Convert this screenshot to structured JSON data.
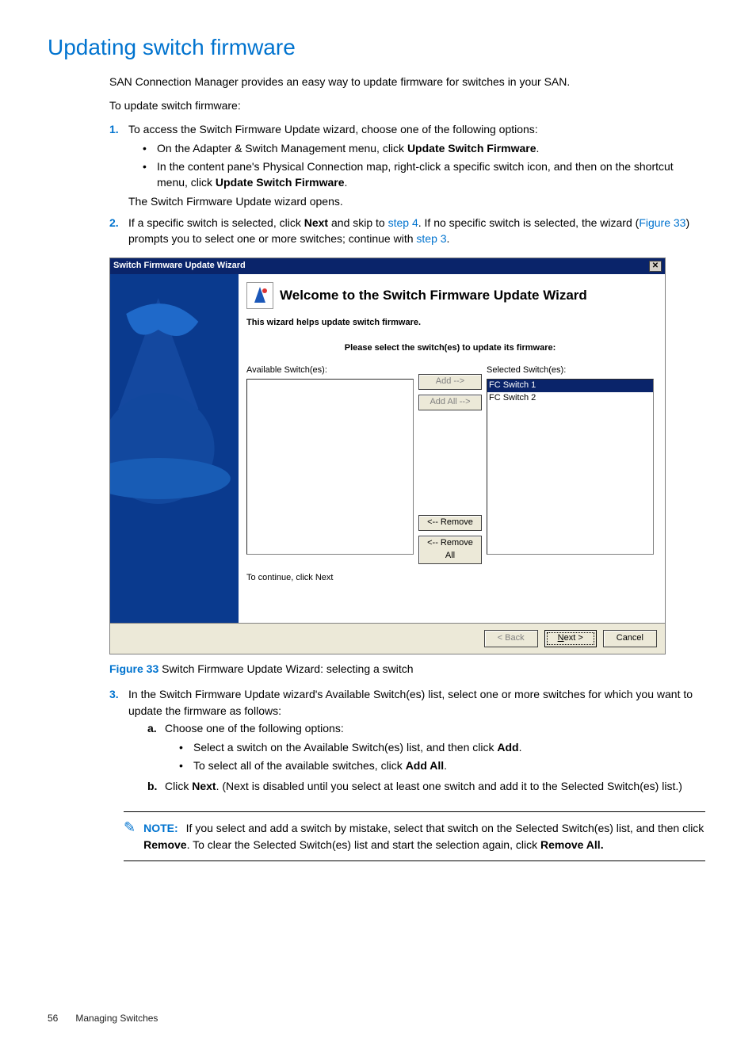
{
  "page_title": "Updating switch firmware",
  "intro1": "SAN Connection Manager provides an easy way to update firmware for switches in your SAN.",
  "intro2": "To update switch firmware:",
  "step1": {
    "text": "To access the Switch Firmware Update wizard, choose one of the following options:",
    "bullets": {
      "b1a": "On the Adapter & Switch Management menu, click ",
      "b1b_bold": "Update Switch Firmware",
      "b1c": ".",
      "b2a": "In the content pane's Physical Connection map, right-click a specific switch icon, and then on the shortcut menu, click ",
      "b2b_bold": "Update Switch Firmware",
      "b2c": "."
    },
    "after": "The Switch Firmware Update wizard opens."
  },
  "step2": {
    "t1": "If a specific switch is selected, click ",
    "t2_bold": "Next",
    "t3": " and skip to ",
    "link1": "step 4",
    "t4": ". If no specific switch is selected, the wizard (",
    "link2": "Figure 33",
    "t5": ") prompts you to select one or more switches; continue with ",
    "link3": "step 3",
    "t6": "."
  },
  "figure": {
    "ref": "Figure 33",
    "caption": " Switch Firmware Update Wizard: selecting a switch"
  },
  "wizard": {
    "title": "Switch Firmware Update Wizard",
    "heading": "Welcome to the Switch Firmware Update Wizard",
    "subtitle": "This wizard helps update switch firmware.",
    "prompt": "Please select the switch(es) to update its firmware:",
    "avail_label": "Available Switch(es):",
    "sel_label": "Selected Switch(es):",
    "selected": [
      "FC Switch 1",
      "FC Switch 2"
    ],
    "btn_add": "Add -->",
    "btn_addall": "Add All -->",
    "btn_remove": "<-- Remove",
    "btn_removeall": "<-- Remove All",
    "continue_hint": "To continue, click Next",
    "back": "< Back",
    "next": "Next >",
    "cancel": "Cancel"
  },
  "step3": {
    "text": "In the Switch Firmware Update wizard's Available Switch(es) list, select one or more switches for which you want to update the firmware as follows:",
    "a_text": "Choose one of the following options:",
    "a_b1a": "Select a switch on the Available Switch(es) list, and then click ",
    "a_b1b_bold": "Add",
    "a_b1c": ".",
    "a_b2a": "To select all of the available switches, click ",
    "a_b2b_bold": "Add All",
    "a_b2c": ".",
    "b_t1": "Click ",
    "b_t2_bold": "Next",
    "b_t3": ". (Next is disabled until you select at least one switch and add it to the Selected Switch(es) list.)"
  },
  "note": {
    "head": "NOTE:",
    "t1": "If you select and add a switch by mistake, select that switch on the Selected Switch(es) list, and then click ",
    "t2_bold": "Remove",
    "t3": ". To clear the Selected Switch(es) list and start the selection again, click ",
    "t4_bold": "Remove All."
  },
  "footer": {
    "page": "56",
    "chapter": "Managing Switches"
  }
}
